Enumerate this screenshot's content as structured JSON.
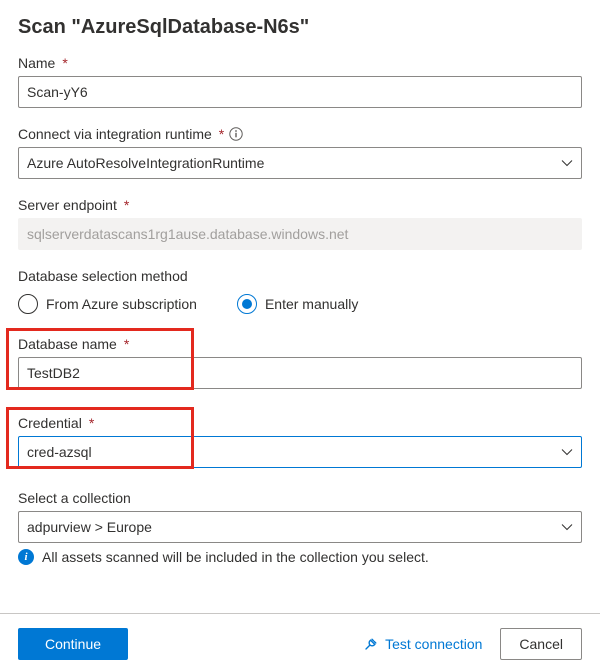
{
  "header": {
    "title": "Scan \"AzureSqlDatabase-N6s\""
  },
  "name": {
    "label": "Name",
    "value": "Scan-yY6"
  },
  "runtime": {
    "label": "Connect via integration runtime",
    "value": "Azure AutoResolveIntegrationRuntime"
  },
  "endpoint": {
    "label": "Server endpoint",
    "value": "sqlserverdatascans1rg1ause.database.windows.net"
  },
  "dbselect": {
    "label": "Database selection method",
    "options": {
      "sub": "From Azure subscription",
      "manual": "Enter manually"
    },
    "selected": "manual"
  },
  "dbname": {
    "label": "Database name",
    "value": "TestDB2"
  },
  "credential": {
    "label": "Credential",
    "value": "cred-azsql"
  },
  "collection": {
    "label": "Select a collection",
    "value": "adpurview > Europe",
    "hint": "All assets scanned will be included in the collection you select."
  },
  "footer": {
    "continue": "Continue",
    "test": "Test connection",
    "cancel": "Cancel"
  }
}
